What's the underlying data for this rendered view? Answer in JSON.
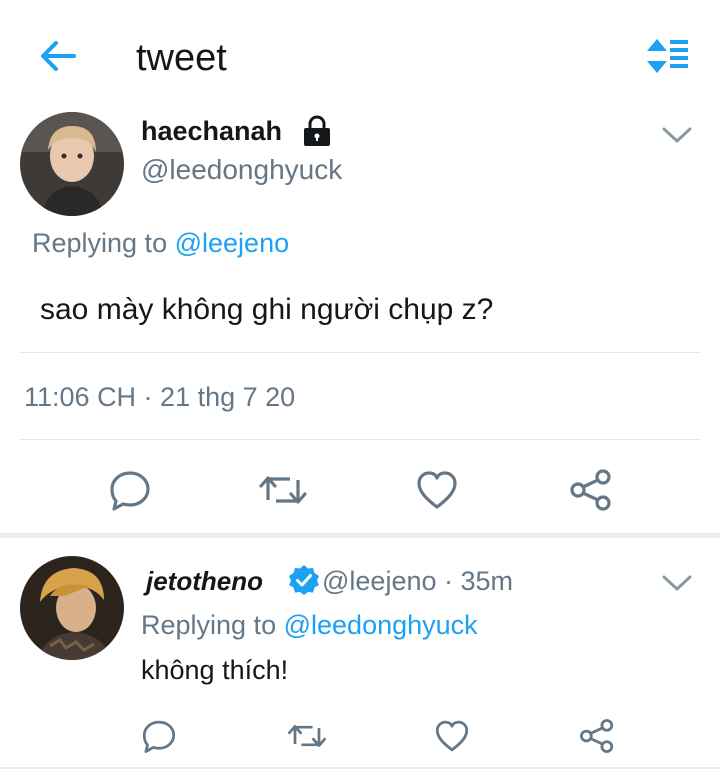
{
  "header": {
    "title": "tweet",
    "back_icon": "back-arrow-icon",
    "sort_icon": "sort-icon",
    "accent": "#1da1f2"
  },
  "main_tweet": {
    "display_name": "haechanah",
    "protected_icon": "lock-icon",
    "handle": "@leedonghyuck",
    "replying_prefix": "Replying to",
    "replying_to": "@leejeno",
    "text": "sao mày không ghi người chụp z?",
    "timestamp": "11:06 CH · 21 thg 7 20",
    "actions": [
      "reply-icon",
      "retweet-icon",
      "like-icon",
      "share-icon"
    ]
  },
  "reply_tweet": {
    "display_name": "jetotheno",
    "verified_icon": "verified-badge-icon",
    "handle_time": "@leejeno · 35m",
    "replying_prefix": "Replying to",
    "replying_to": "@leedonghyuck",
    "text": "không thích!",
    "actions": [
      "reply-icon",
      "retweet-icon",
      "like-icon",
      "share-icon"
    ]
  },
  "colors": {
    "text_primary": "#14171a",
    "text_secondary": "#657786",
    "link": "#1da1f2",
    "divider": "#e1e8ed"
  }
}
